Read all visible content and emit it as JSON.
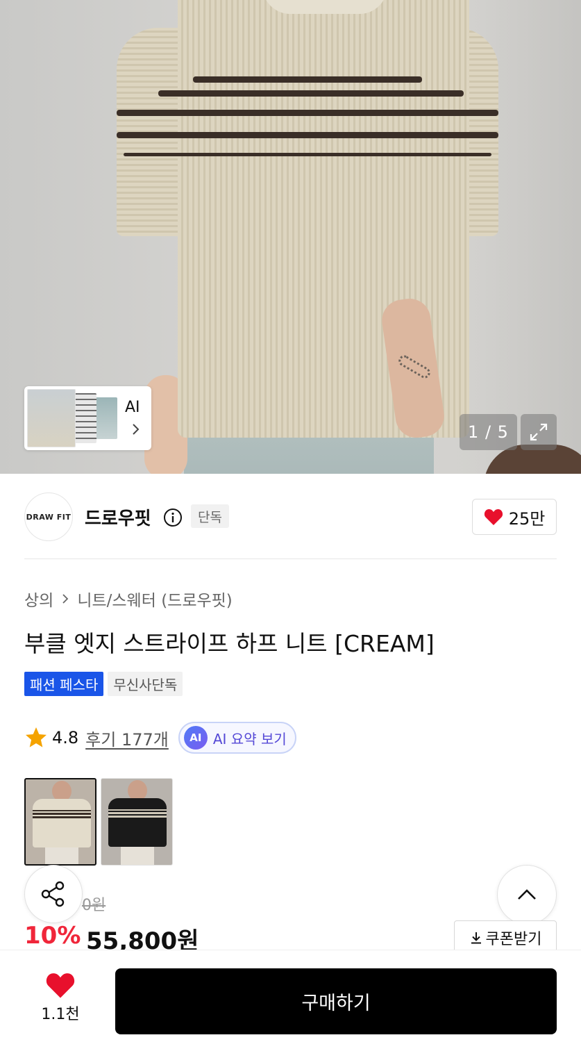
{
  "gallery": {
    "pager": "1 / 5",
    "ai_label": "AI"
  },
  "brand": {
    "logo_text": "DRAW FIT",
    "name": "드로우핏",
    "exclusive_badge": "단독",
    "like_count": "25만"
  },
  "product": {
    "breadcrumb": [
      "상의",
      "니트/스웨터 (드로우핏)"
    ],
    "title": "부클 엣지 스트라이프 하프 니트 [CREAM]",
    "tags": [
      "패션 페스타",
      "무신사단독"
    ],
    "rating": "4.8",
    "review_link": "후기 177개",
    "ai_summary": "AI 요약 보기",
    "original_price": "0원",
    "discount_rate": "10%",
    "sale_price": "55,800원",
    "coupon_label": "쿠폰받기"
  },
  "bottom_bar": {
    "wish_count": "1.1천",
    "buy_label": "구매하기"
  },
  "colors": {
    "accent_red": "#f0263a",
    "tag_blue": "#1a55e8",
    "heart": "#e8102c"
  },
  "icons": [
    "chevron-right-icon",
    "expand-icon",
    "info-icon",
    "heart-icon",
    "star-icon",
    "share-icon",
    "chevron-up-icon",
    "download-icon"
  ]
}
